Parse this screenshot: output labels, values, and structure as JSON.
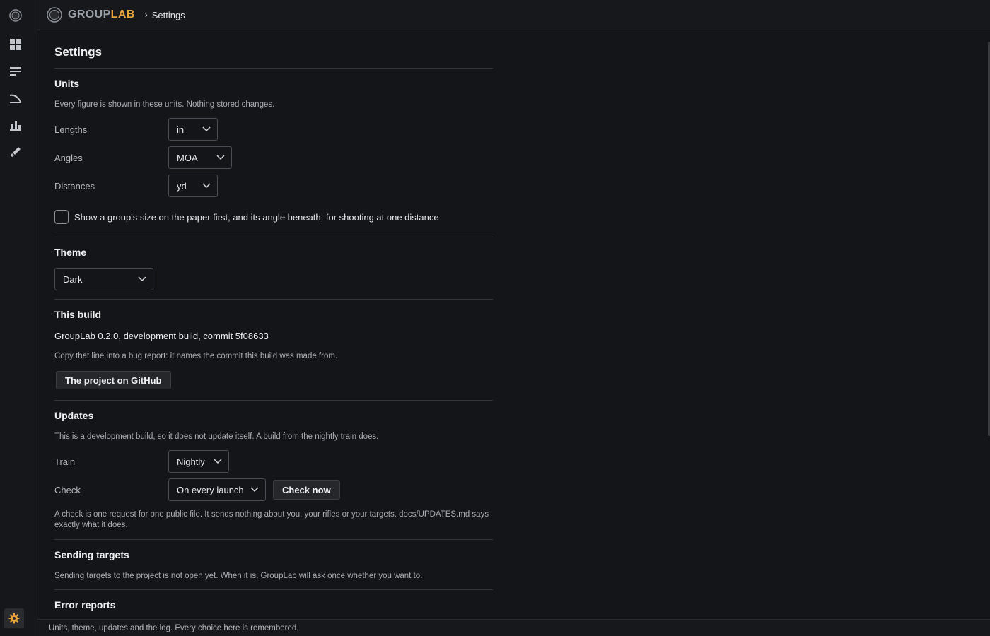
{
  "app": {
    "brand_prefix": "GROUP",
    "brand_accent": "LAB",
    "accent_color": "#e8a33a"
  },
  "breadcrumb": {
    "separator": "›",
    "current": "Settings"
  },
  "rail": {
    "items": [
      {
        "icon": "target-logo-icon"
      },
      {
        "icon": "dashboard-grid-icon"
      },
      {
        "icon": "list-lines-icon"
      },
      {
        "icon": "trajectory-icon"
      },
      {
        "icon": "bar-chart-icon"
      },
      {
        "icon": "bullet-icon"
      }
    ],
    "bottom_item": {
      "icon": "gear-icon",
      "active": true
    }
  },
  "settings": {
    "title": "Settings",
    "units": {
      "heading": "Units",
      "note": "Every figure is shown in these units. Nothing stored changes.",
      "lengths": {
        "label": "Lengths",
        "value": "in"
      },
      "angles": {
        "label": "Angles",
        "value": "MOA"
      },
      "distances": {
        "label": "Distances",
        "value": "yd"
      },
      "paper_first": {
        "label": "Show a group's size on the paper first, and its angle beneath, for shooting at one distance",
        "checked": false
      }
    },
    "theme": {
      "heading": "Theme",
      "value": "Dark"
    },
    "build": {
      "heading": "This build",
      "line": "GroupLab 0.2.0, development build, commit 5f08633",
      "note": "Copy that line into a bug report: it names the commit this build was made from.",
      "github_button": "The project on GitHub"
    },
    "updates": {
      "heading": "Updates",
      "note": "This is a development build, so it does not update itself. A build from the nightly train does.",
      "train": {
        "label": "Train",
        "value": "Nightly"
      },
      "check": {
        "label": "Check",
        "value": "On every launch",
        "button": "Check now"
      },
      "footnote": "A check is one request for one public file. It sends nothing about you, your rifles or your targets. docs/UPDATES.md says exactly what it does."
    },
    "sending": {
      "heading": "Sending targets",
      "note": "Sending targets to the project is not open yet. When it is, GroupLab will ask once whether you want to."
    },
    "errors": {
      "heading": "Error reports"
    }
  },
  "status": {
    "text": "Units, theme, updates and the log. Every choice here is remembered."
  }
}
